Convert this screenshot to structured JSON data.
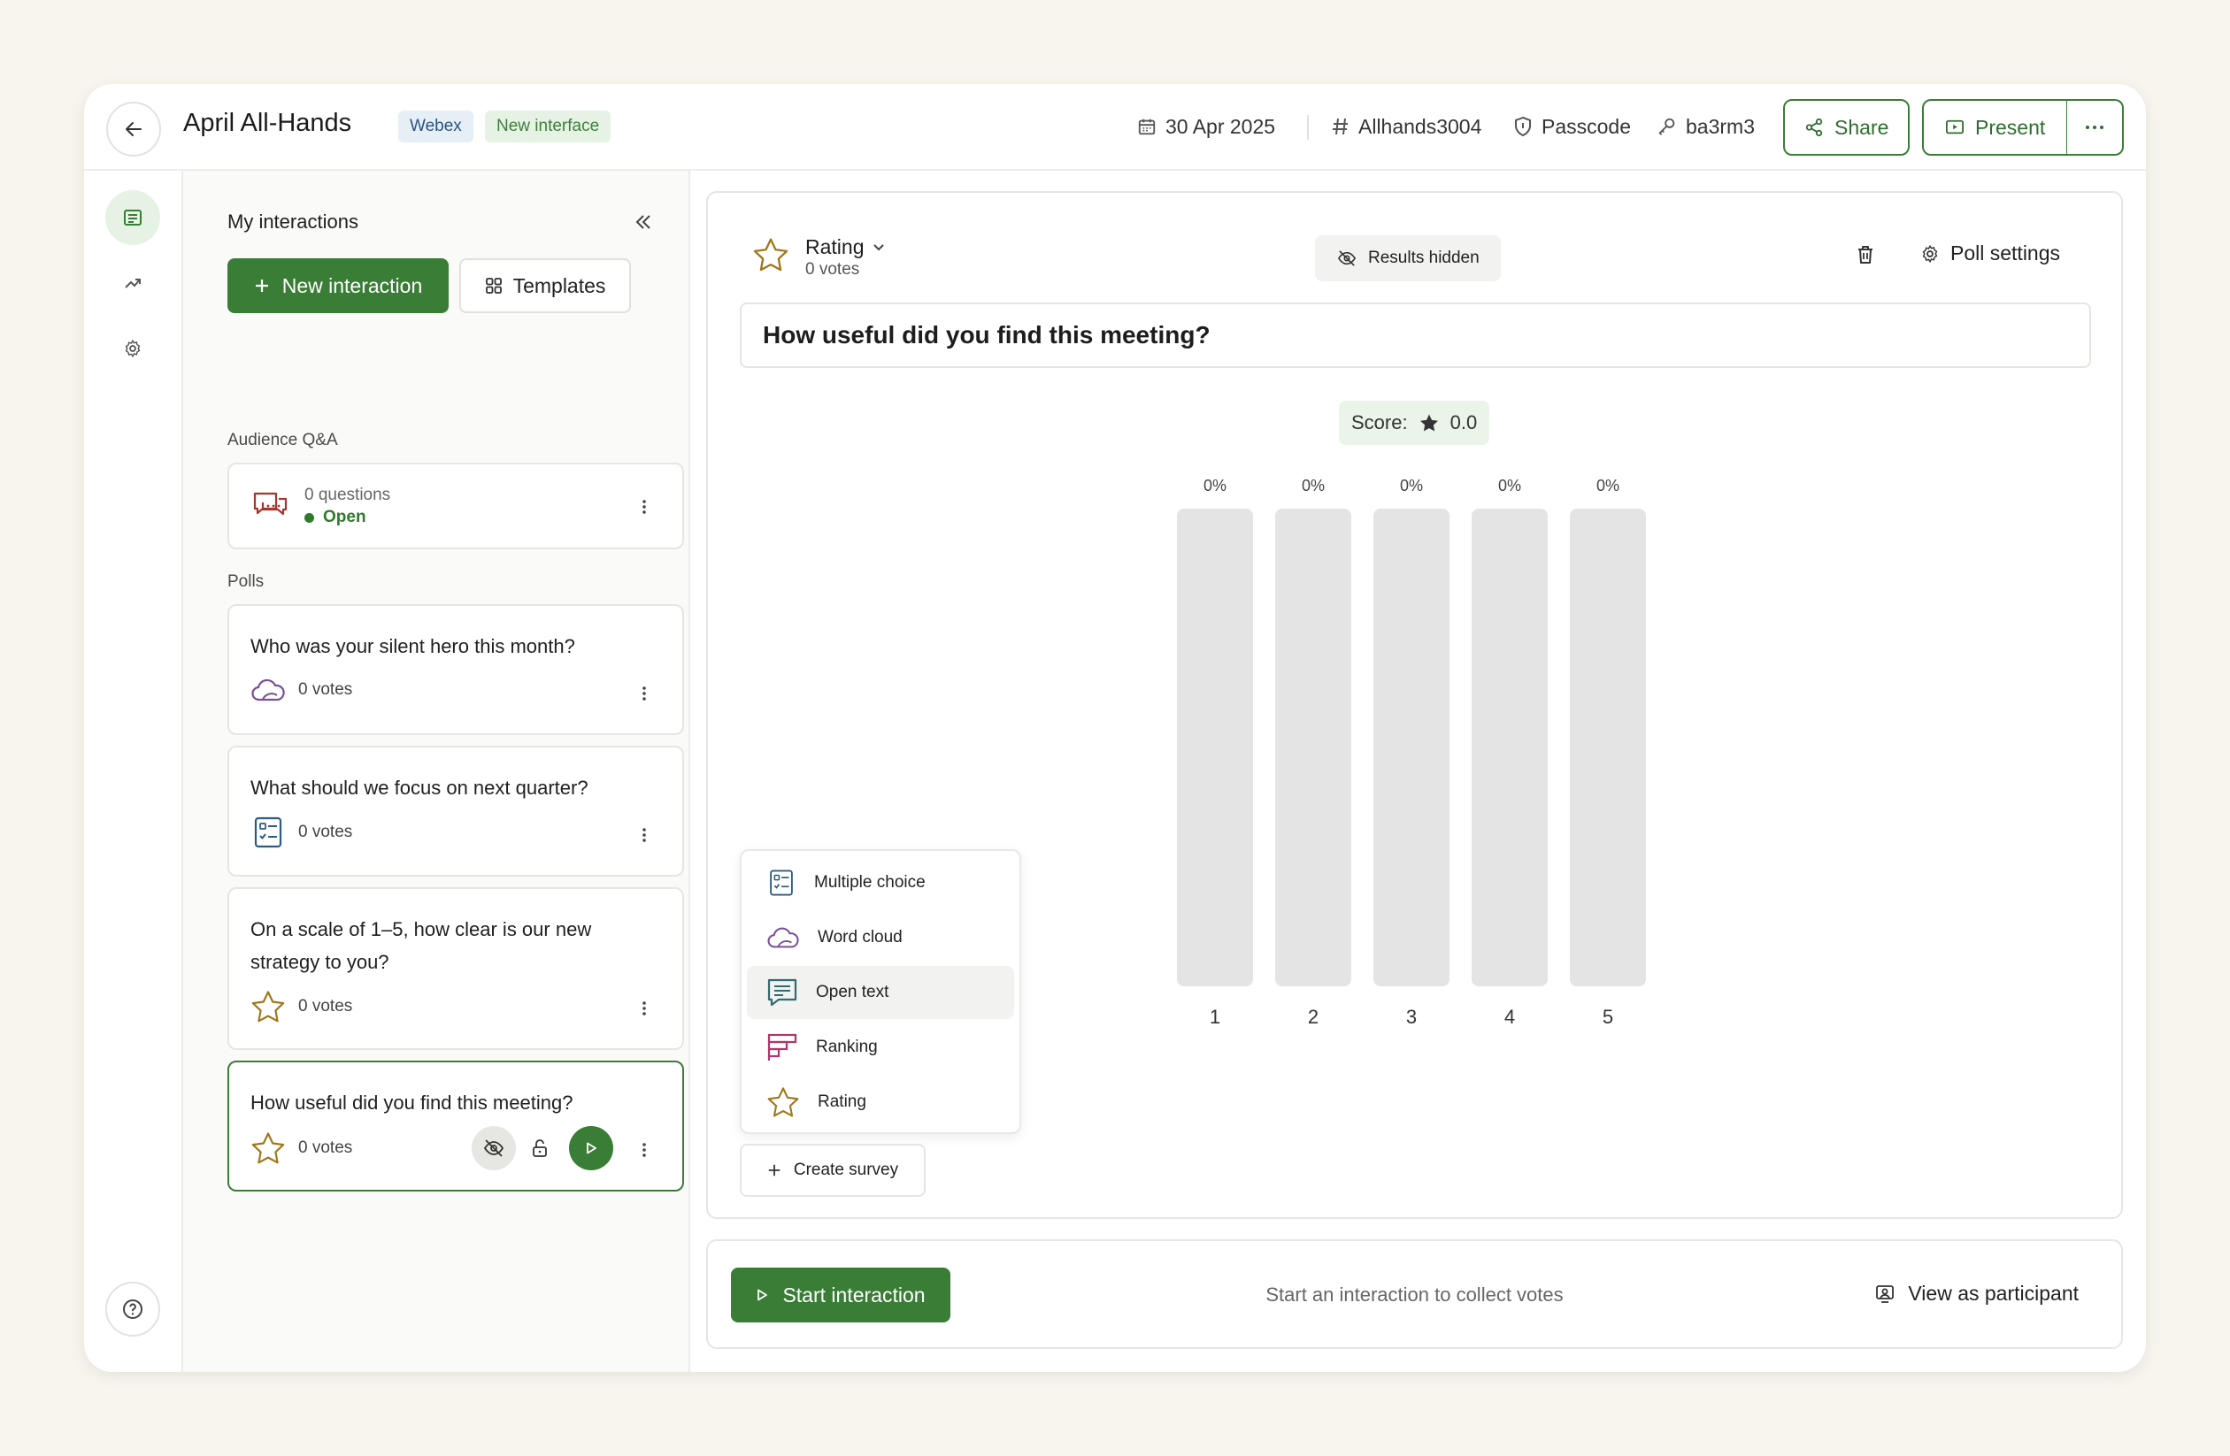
{
  "header": {
    "title": "April All-Hands",
    "badges": {
      "webex": "Webex",
      "new_interface": "New interface"
    },
    "date": "30 Apr 2025",
    "event_code": "Allhands3004",
    "passcode_label": "Passcode",
    "passcode_value": "ba3rm3",
    "share_label": "Share",
    "present_label": "Present"
  },
  "panel": {
    "title": "My interactions",
    "new_interaction_label": "New interaction",
    "templates_label": "Templates",
    "qa_section_label": "Audience Q&A",
    "qa": {
      "count": "0 questions",
      "status": "Open"
    },
    "polls_section_label": "Polls",
    "polls": [
      {
        "question": "Who was your silent hero this month?",
        "votes": "0 votes",
        "icon": "word-cloud-icon"
      },
      {
        "question": "What should we focus on next quarter?",
        "votes": "0 votes",
        "icon": "multiple-choice-icon"
      },
      {
        "question": "On a scale of 1–5, how clear is our new strategy to you?",
        "votes": "0 votes",
        "icon": "star-icon"
      },
      {
        "question": "How useful did you find this meeting?",
        "votes": "0 votes",
        "icon": "star-icon"
      }
    ]
  },
  "poll": {
    "type_label": "Rating",
    "votes": "0 votes",
    "results_hidden_label": "Results hidden",
    "settings_label": "Poll settings",
    "question": "How useful did you find this meeting?",
    "score_label": "Score:",
    "score_value": "0.0"
  },
  "chart_data": {
    "type": "bar",
    "categories": [
      "1",
      "2",
      "3",
      "4",
      "5"
    ],
    "values": [
      0,
      0,
      0,
      0,
      0
    ],
    "value_labels": [
      "0%",
      "0%",
      "0%",
      "0%",
      "0%"
    ],
    "ylim": [
      0,
      100
    ]
  },
  "menu": {
    "items": [
      {
        "label": "Multiple choice",
        "icon": "multiple-choice-icon"
      },
      {
        "label": "Word cloud",
        "icon": "word-cloud-icon"
      },
      {
        "label": "Open text",
        "icon": "open-text-icon"
      },
      {
        "label": "Ranking",
        "icon": "ranking-icon"
      },
      {
        "label": "Rating",
        "icon": "star-icon"
      }
    ],
    "create_survey_label": "Create survey"
  },
  "footer": {
    "start_label": "Start interaction",
    "hint": "Start an interaction to collect votes",
    "view_participant_label": "View as participant"
  },
  "colors": {
    "brand_green": "#3a7d36",
    "bar_track": "#e4e4e4",
    "star_gold": "#a0781c",
    "word_cloud_purple": "#7a4f95",
    "mc_blue": "#2f5b7f",
    "ranking_pink": "#b0356a",
    "qa_red": "#a5362f",
    "open_text_teal": "#2f6b70"
  }
}
